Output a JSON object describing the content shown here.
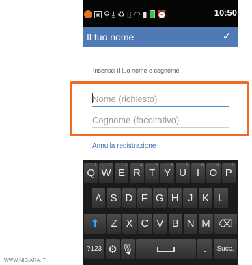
{
  "status_bar": {
    "time": "10:50",
    "icons": [
      "app-notification-icon",
      "image-icon",
      "usb-icon",
      "download-icon",
      "recycle-icon",
      "vibrate-icon",
      "wifi-icon",
      "signal-icon",
      "battery-icon",
      "alarm-icon"
    ]
  },
  "header": {
    "title": "Il tuo nome",
    "confirm_icon": "check-icon"
  },
  "prompt": "Inserisci il tuo nome e cognome",
  "form": {
    "first_name": {
      "value": "",
      "placeholder": "Nome (richiesto)"
    },
    "last_name": {
      "value": "",
      "placeholder": "Cognome (facoltativo)"
    }
  },
  "cancel_link": "Annulla registrazione",
  "keyboard": {
    "row1": [
      {
        "label": "Q",
        "sup": "1"
      },
      {
        "label": "W",
        "sup": "2"
      },
      {
        "label": "E",
        "sup": "3"
      },
      {
        "label": "R",
        "sup": "4"
      },
      {
        "label": "T",
        "sup": "5"
      },
      {
        "label": "Y",
        "sup": "6"
      },
      {
        "label": "U",
        "sup": "7"
      },
      {
        "label": "I",
        "sup": "8"
      },
      {
        "label": "O",
        "sup": "9"
      },
      {
        "label": "P",
        "sup": "0"
      }
    ],
    "row2": [
      "A",
      "S",
      "D",
      "F",
      "G",
      "H",
      "J",
      "K",
      "L"
    ],
    "row3": [
      "Z",
      "X",
      "C",
      "V",
      "B",
      "N",
      "M"
    ],
    "symbols_label": "?123",
    "next_label": "Succ."
  },
  "watermark": "WWW.NIGIARA.IT",
  "colors": {
    "header": "#507ab3",
    "highlight": "#f26a21",
    "link": "#3a6db6",
    "shift": "#33a5ff"
  }
}
